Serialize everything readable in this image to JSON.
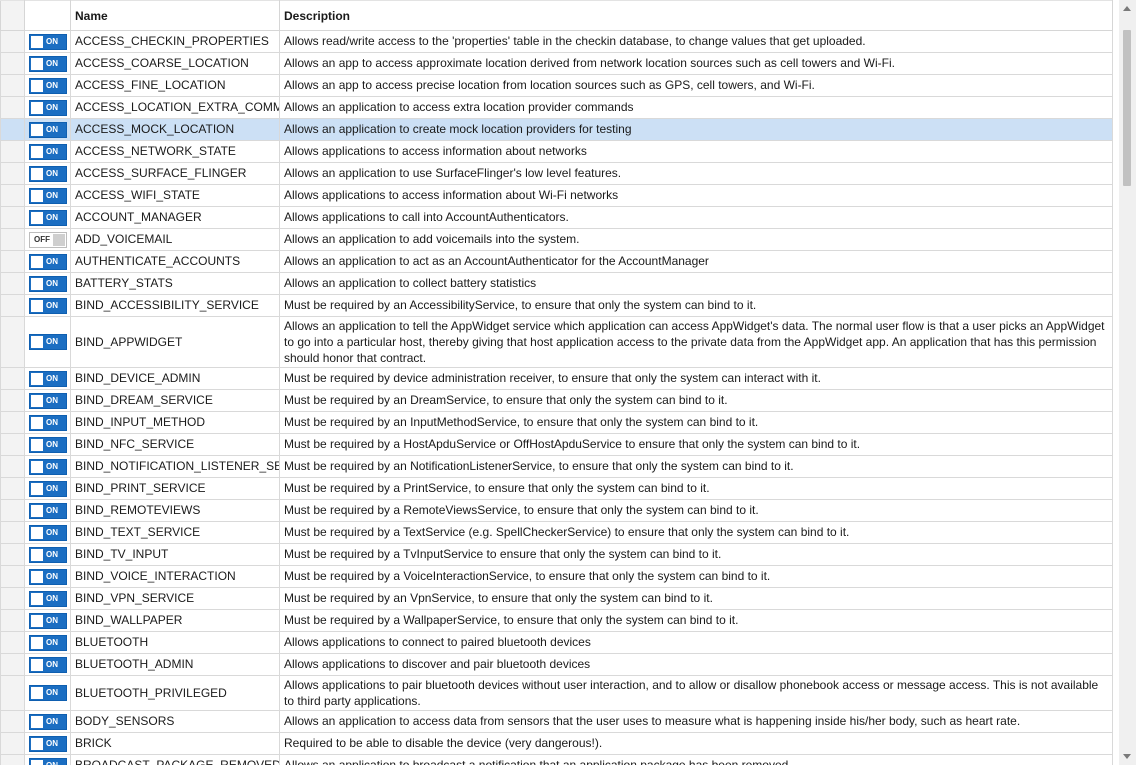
{
  "columns": {
    "name": "Name",
    "description": "Description"
  },
  "toggle_labels": {
    "on": "ON",
    "off": "OFF"
  },
  "colors": {
    "toggle_on": "#1b6ec2",
    "selected_row": "#cce0f5"
  },
  "rows": [
    {
      "name": "ACCESS_CHECKIN_PROPERTIES",
      "enabled": true,
      "description": "Allows read/write access to the 'properties' table in the checkin database, to change values that get uploaded."
    },
    {
      "name": "ACCESS_COARSE_LOCATION",
      "enabled": true,
      "description": "Allows an app to access approximate location derived from network location sources such as cell towers and Wi-Fi."
    },
    {
      "name": "ACCESS_FINE_LOCATION",
      "enabled": true,
      "description": "Allows an app to access precise location from location sources such as GPS, cell towers, and Wi-Fi."
    },
    {
      "name": "ACCESS_LOCATION_EXTRA_COMMAN",
      "enabled": true,
      "description": "Allows an application to access extra location provider commands"
    },
    {
      "name": "ACCESS_MOCK_LOCATION",
      "enabled": true,
      "selected": true,
      "description": "Allows an application to create mock location providers for testing"
    },
    {
      "name": "ACCESS_NETWORK_STATE",
      "enabled": true,
      "description": "Allows applications to access information about networks"
    },
    {
      "name": "ACCESS_SURFACE_FLINGER",
      "enabled": true,
      "description": "Allows an application to use SurfaceFlinger's low level features."
    },
    {
      "name": "ACCESS_WIFI_STATE",
      "enabled": true,
      "description": "Allows applications to access information about Wi-Fi networks"
    },
    {
      "name": "ACCOUNT_MANAGER",
      "enabled": true,
      "description": "Allows applications to call into AccountAuthenticators."
    },
    {
      "name": "ADD_VOICEMAIL",
      "enabled": false,
      "description": "Allows an application to add voicemails into the system."
    },
    {
      "name": "AUTHENTICATE_ACCOUNTS",
      "enabled": true,
      "description": "Allows an application to act as an AccountAuthenticator for the AccountManager"
    },
    {
      "name": "BATTERY_STATS",
      "enabled": true,
      "description": "Allows an application to collect battery statistics"
    },
    {
      "name": "BIND_ACCESSIBILITY_SERVICE",
      "enabled": true,
      "description": "Must be required by an AccessibilityService, to ensure that only the system can bind to it."
    },
    {
      "name": "BIND_APPWIDGET",
      "enabled": true,
      "lines": 3,
      "description": "Allows an application to tell the AppWidget service which application can access AppWidget's data. The normal user flow is that a user picks an AppWidget to go into a particular host, thereby giving that host application access to the private data from the AppWidget app. An application that has this permission should honor that contract."
    },
    {
      "name": "BIND_DEVICE_ADMIN",
      "enabled": true,
      "description": "Must be required by device administration receiver, to ensure that only the system can interact with it."
    },
    {
      "name": "BIND_DREAM_SERVICE",
      "enabled": true,
      "description": "Must be required by an DreamService, to ensure that only the system can bind to it."
    },
    {
      "name": "BIND_INPUT_METHOD",
      "enabled": true,
      "description": "Must be required by an InputMethodService, to ensure that only the system can bind to it."
    },
    {
      "name": "BIND_NFC_SERVICE",
      "enabled": true,
      "description": "Must be required by a HostApduService or OffHostApduService to ensure that only the system can bind to it."
    },
    {
      "name": "BIND_NOTIFICATION_LISTENER_SERVI",
      "enabled": true,
      "description": "Must be required by an NotificationListenerService, to ensure that only the system can bind to it."
    },
    {
      "name": "BIND_PRINT_SERVICE",
      "enabled": true,
      "description": "Must be required by a PrintService, to ensure that only the system can bind to it."
    },
    {
      "name": "BIND_REMOTEVIEWS",
      "enabled": true,
      "description": "Must be required by a RemoteViewsService, to ensure that only the system can bind to it."
    },
    {
      "name": "BIND_TEXT_SERVICE",
      "enabled": true,
      "description": "Must be required by a TextService (e.g. SpellCheckerService) to ensure that only the system can bind to it."
    },
    {
      "name": "BIND_TV_INPUT",
      "enabled": true,
      "description": "Must be required by a TvInputService to ensure that only the system can bind to it."
    },
    {
      "name": "BIND_VOICE_INTERACTION",
      "enabled": true,
      "description": "Must be required by a VoiceInteractionService, to ensure that only the system can bind to it."
    },
    {
      "name": "BIND_VPN_SERVICE",
      "enabled": true,
      "description": "Must be required by an VpnService, to ensure that only the system can bind to it."
    },
    {
      "name": "BIND_WALLPAPER",
      "enabled": true,
      "description": "Must be required by a WallpaperService, to ensure that only the system can bind to it."
    },
    {
      "name": "BLUETOOTH",
      "enabled": true,
      "description": "Allows applications to connect to paired bluetooth devices"
    },
    {
      "name": "BLUETOOTH_ADMIN",
      "enabled": true,
      "description": "Allows applications to discover and pair bluetooth devices"
    },
    {
      "name": "BLUETOOTH_PRIVILEGED",
      "enabled": true,
      "lines": 2,
      "description": "Allows applications to pair bluetooth devices without user interaction, and to allow or disallow phonebook access or message access. This is not available to third party applications."
    },
    {
      "name": "BODY_SENSORS",
      "enabled": true,
      "description": "Allows an application to access data from sensors that the user uses to measure what is happening inside his/her body, such as heart rate."
    },
    {
      "name": "BRICK",
      "enabled": true,
      "description": "Required to be able to disable the device (very dangerous!)."
    },
    {
      "name": "BROADCAST_PACKAGE_REMOVED",
      "enabled": true,
      "description": "Allows an application to broadcast a notification that an application package has been removed."
    }
  ]
}
